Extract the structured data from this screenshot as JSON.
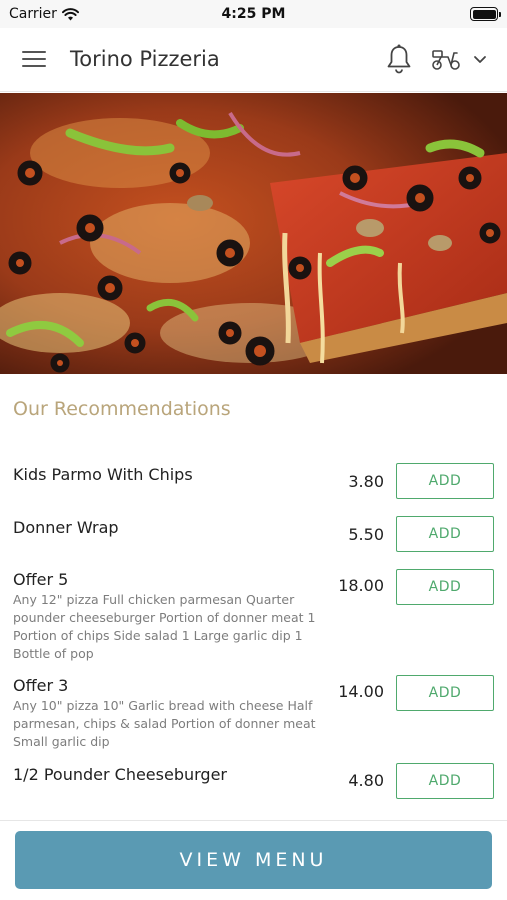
{
  "status_bar": {
    "carrier": "Carrier",
    "time": "4:25 PM"
  },
  "nav": {
    "title": "Torino Pizzeria",
    "icons": [
      "hamburger-menu-icon",
      "bell-icon",
      "moped-icon",
      "chevron-down-icon"
    ]
  },
  "hero": {
    "image": "pizza-photo"
  },
  "section": {
    "title": "Our Recommendations"
  },
  "items": [
    {
      "name": "Kids Parmo With Chips",
      "description": "",
      "price": "3.80",
      "action": "ADD"
    },
    {
      "name": "Donner Wrap",
      "description": "",
      "price": "5.50",
      "action": "ADD"
    },
    {
      "name": "Offer 5",
      "description": "Any 12\" pizza  Full chicken parmesan  Quarter pounder cheeseburger  Portion of donner meat  1 Portion of chips  Side salad  1 Large garlic dip  1 Bottle of pop",
      "price": "18.00",
      "action": "ADD"
    },
    {
      "name": "Offer 3",
      "description": "Any 10\" pizza  10\" Garlic bread with cheese  Half parmesan, chips & salad  Portion of donner meat  Small garlic dip",
      "price": "14.00",
      "action": "ADD"
    },
    {
      "name": "1/2 Pounder Cheeseburger",
      "description": "",
      "price": "4.80",
      "action": "ADD"
    }
  ],
  "footer": {
    "button_label": "VIEW MENU"
  },
  "colors": {
    "accent_green": "#4fa96d",
    "section_title": "#b9a57b",
    "primary_button": "#5a9ab3"
  }
}
